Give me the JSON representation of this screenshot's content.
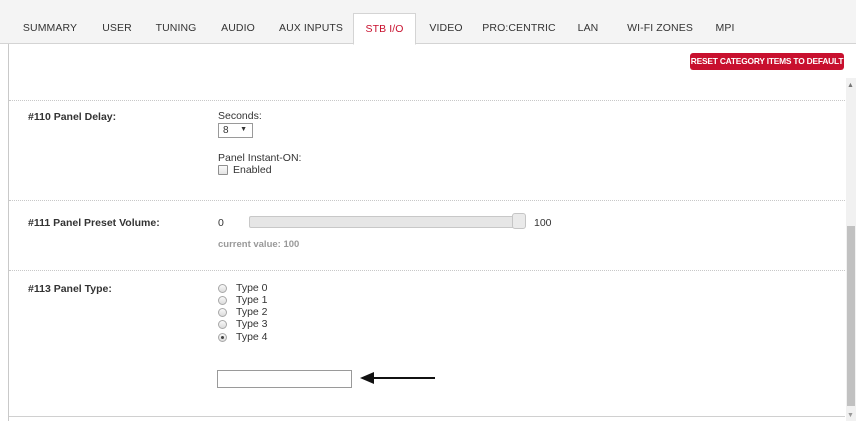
{
  "tabs": [
    {
      "label": "SUMMARY"
    },
    {
      "label": "USER"
    },
    {
      "label": "TUNING"
    },
    {
      "label": "AUDIO"
    },
    {
      "label": "AUX INPUTS"
    },
    {
      "label": "STB I/O",
      "active": true
    },
    {
      "label": "VIDEO"
    },
    {
      "label": "PRO:CENTRIC"
    },
    {
      "label": "LAN"
    },
    {
      "label": "WI-FI ZONES"
    },
    {
      "label": "MPI"
    }
  ],
  "reset_button": "RESET CATEGORY ITEMS TO DEFAULT",
  "colors": {
    "accent": "#c8102e",
    "tab_bar": "#f4f4f4",
    "muted": "#999999"
  },
  "panel_delay": {
    "label": "#110 Panel Delay:",
    "seconds_label": "Seconds:",
    "seconds_value": "8",
    "instant_on_label": "Panel Instant-ON:",
    "enabled_label": "Enabled",
    "enabled_checked": false
  },
  "preset_volume": {
    "label": "#111 Panel Preset Volume:",
    "min": "0",
    "max": "100",
    "value": 100,
    "current_value_text": "current value: 100"
  },
  "panel_type": {
    "label": "#113 Panel Type:",
    "options": [
      "Type 0",
      "Type 1",
      "Type 2",
      "Type 3",
      "Type 4"
    ],
    "selected": "Type 4",
    "input_value": ""
  },
  "icons": {
    "arrow": "arrow-left-icon",
    "select_caret": "caret-down-icon"
  }
}
